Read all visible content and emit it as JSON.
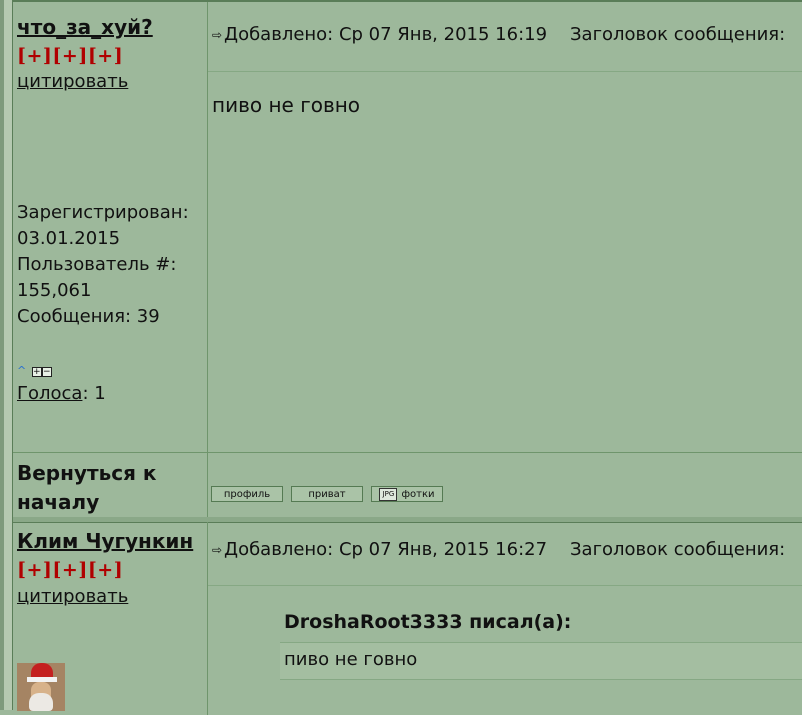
{
  "posts": [
    {
      "username": "что_за_хуй?",
      "plus": [
        "[+]",
        "[+]",
        "[+]"
      ],
      "quote_link": "цитировать",
      "registered_label": "Зарегистрирован:",
      "registered_date": "03.01.2015",
      "user_number_label": "Пользователь #:",
      "user_number": "155,061",
      "messages": "Сообщения: 39",
      "votes_link": "Голоса",
      "votes_count": ": 1",
      "added": "Добавлено: Ср 07 Янв, 2015 16:19",
      "subject": "Заголовок сообщения:",
      "message": "пиво не говно"
    },
    {
      "username": "Клим Чугункин",
      "plus": [
        "[+]",
        "[+]",
        "[+]"
      ],
      "quote_link": "цитировать",
      "added": "Добавлено: Ср 07 Янв, 2015 16:27",
      "subject": "Заголовок сообщения:",
      "quote_author": "DroshaRoot3333 писал(а):",
      "quote_text": "пиво не говно"
    }
  ],
  "back_to_top": "Вернуться к началу",
  "buttons": {
    "profile": "профиль",
    "private": "приват",
    "photos": "фотки",
    "photos_icon_text": "JPG"
  },
  "icons": {
    "post_arrow": "⇨",
    "vote_up": "^",
    "vote_plus": "+",
    "vote_minus": "−"
  },
  "colors": {
    "background": "#9db89b",
    "plus_red": "#b00000",
    "border": "#5a7d58"
  }
}
